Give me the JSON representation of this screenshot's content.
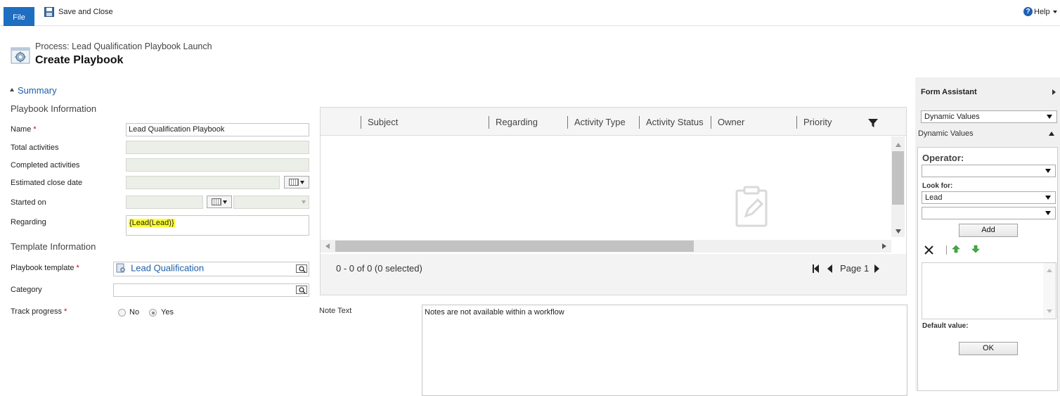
{
  "ribbon": {
    "file_label": "File",
    "save_close_label": "Save and Close",
    "help_label": "Help"
  },
  "header": {
    "process_label": "Process: Lead Qualification Playbook Launch",
    "title": "Create Playbook"
  },
  "summary": {
    "label": "Summary"
  },
  "playbook_info": {
    "heading": "Playbook Information",
    "name_label": "Name",
    "name_value": "Lead Qualification Playbook",
    "total_activities_label": "Total activities",
    "completed_activities_label": "Completed activities",
    "estimated_close_label": "Estimated close date",
    "started_on_label": "Started on",
    "regarding_label": "Regarding",
    "regarding_value": "{Lead(Lead)}"
  },
  "template_info": {
    "heading": "Template Information",
    "playbook_template_label": "Playbook template",
    "playbook_template_value": "Lead Qualification",
    "category_label": "Category",
    "track_progress_label": "Track progress",
    "track_progress_options": [
      "No",
      "Yes"
    ],
    "track_progress_selected": "Yes"
  },
  "grid": {
    "columns": [
      "Subject",
      "Regarding",
      "Activity Type",
      "Activity Status",
      "Owner",
      "Priority"
    ],
    "count_text": "0 - 0 of 0 (0 selected)",
    "page_text": "Page 1"
  },
  "notes": {
    "label": "Note Text",
    "value": "Notes are not available within a workflow"
  },
  "form_assistant": {
    "title": "Form Assistant",
    "top_select": "Dynamic Values",
    "section_label": "Dynamic Values",
    "operator_label": "Operator:",
    "operator_value": "",
    "look_for_label": "Look for:",
    "look_for_value": "Lead",
    "look_for_field": "",
    "add_label": "Add",
    "default_value_label": "Default value:",
    "ok_label": "OK"
  }
}
